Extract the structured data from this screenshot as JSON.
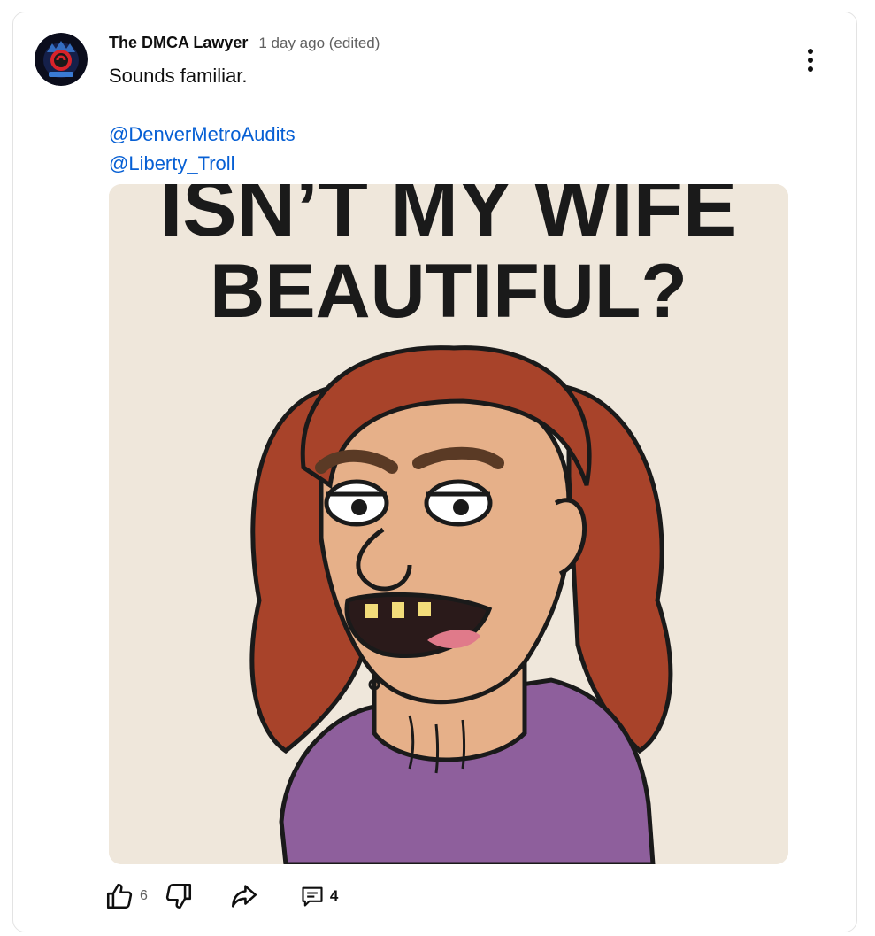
{
  "comment": {
    "author": "The DMCA Lawyer",
    "timestamp": "1 day ago (edited)",
    "text": "Sounds familiar.",
    "mentions": [
      "@DenverMetroAudits",
      "@Liberty_Troll"
    ],
    "avatar_icon": "channel-avatar-logo",
    "image": {
      "caption_line1": "ISN’T MY WIFE",
      "caption_line2": "BEAUTIFUL?",
      "subject": "cartoon-woman-illustration"
    }
  },
  "actions": {
    "like_icon": "thumbs-up-icon",
    "like_count": "6",
    "dislike_icon": "thumbs-down-icon",
    "share_icon": "share-icon",
    "reply_icon": "reply-comment-icon",
    "reply_count": "4",
    "menu_icon": "more-vert-icon"
  },
  "colors": {
    "link": "#065fd4",
    "text": "#0f0f0f",
    "secondary": "#606060",
    "image_bg": "#efe7db",
    "hair": "#a8432a",
    "skin": "#e6b089",
    "shirt": "#8e5f9c"
  }
}
